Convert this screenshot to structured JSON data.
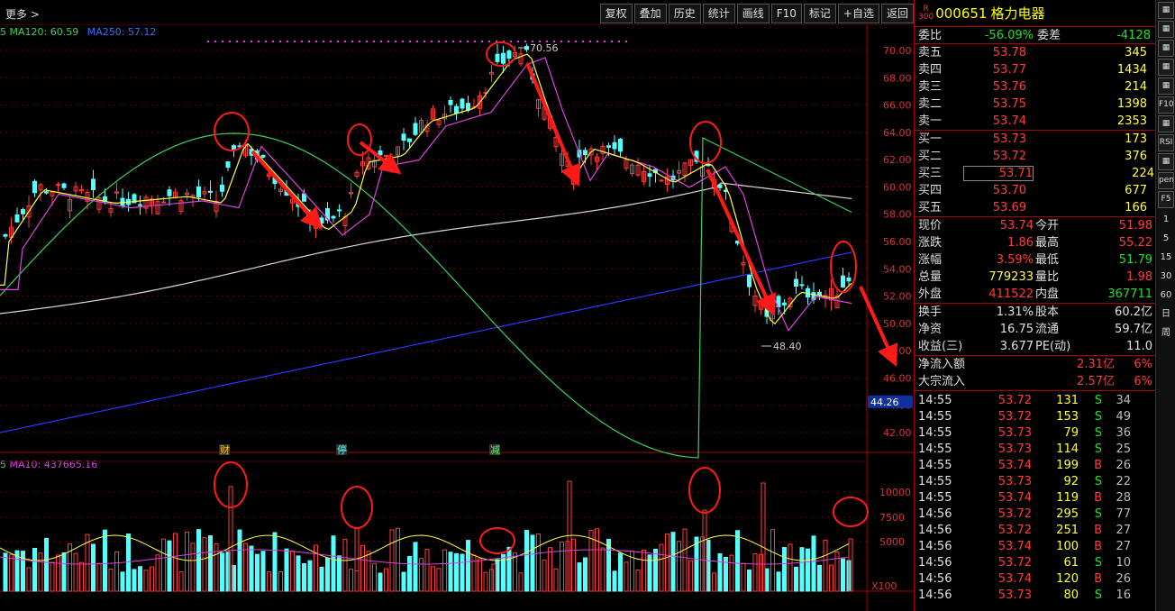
{
  "toolbar": {
    "more": "更多 >",
    "buttons": [
      "复权",
      "叠加",
      "历史",
      "统计",
      "画线",
      "F10",
      "标记",
      "+自选",
      "返回"
    ]
  },
  "chart": {
    "ma120_label": "MA120: 60.59",
    "ma250_label": "MA250: 57.12",
    "vol_label": "MA10: 437665.16",
    "price_ticks": [
      "70.00",
      "68.00",
      "66.00",
      "64.00",
      "62.00",
      "60.00",
      "58.00",
      "56.00",
      "54.00",
      "52.00",
      "50.00",
      "48.00",
      "46.00",
      "44.00",
      "42.00"
    ],
    "highlight_price": "44.26",
    "vol_ticks": [
      "10000",
      "7500",
      "5000"
    ],
    "vol_unit": "X100",
    "high_label": "70.56",
    "low_label": "48.40",
    "events": [
      "财",
      "停",
      "减"
    ],
    "last_tick": "5"
  },
  "stock": {
    "index_tag": "R\n300",
    "code": "000651",
    "name": "格力电器"
  },
  "weibi": {
    "label1": "委比",
    "v1": "-56.09%",
    "label2": "委差",
    "v2": "-4128"
  },
  "sell": [
    {
      "l": "卖五",
      "p": "53.78",
      "v": "345"
    },
    {
      "l": "卖四",
      "p": "53.77",
      "v": "1434"
    },
    {
      "l": "卖三",
      "p": "53.76",
      "v": "214"
    },
    {
      "l": "卖二",
      "p": "53.75",
      "v": "1398"
    },
    {
      "l": "卖一",
      "p": "53.74",
      "v": "2353"
    }
  ],
  "buy": [
    {
      "l": "买一",
      "p": "53.73",
      "v": "173"
    },
    {
      "l": "买二",
      "p": "53.72",
      "v": "376"
    },
    {
      "l": "买三",
      "p": "53.71",
      "v": "224"
    },
    {
      "l": "买四",
      "p": "53.70",
      "v": "677"
    },
    {
      "l": "买五",
      "p": "53.69",
      "v": "166"
    }
  ],
  "quote": [
    {
      "a": "现价",
      "av": "53.74",
      "b": "今开",
      "bv": "51.98"
    },
    {
      "a": "涨跌",
      "av": "1.86",
      "b": "最高",
      "bv": "55.22"
    },
    {
      "a": "涨幅",
      "av": "3.59%",
      "b": "最低",
      "bv": "51.79"
    },
    {
      "a": "总量",
      "av": "779233",
      "b": "量比",
      "bv": "1.98"
    },
    {
      "a": "外盘",
      "av": "411522",
      "b": "内盘",
      "bv": "367711"
    }
  ],
  "info": [
    {
      "a": "换手",
      "av": "1.31%",
      "b": "股本",
      "bv": "60.2亿"
    },
    {
      "a": "净资",
      "av": "16.75",
      "b": "流通",
      "bv": "59.7亿"
    },
    {
      "a": "收益(三)",
      "av": "3.677",
      "b": "PE(动)",
      "bv": "11.0"
    }
  ],
  "flow": [
    {
      "a": "净流入额",
      "av": "2.31亿",
      "b": "6%"
    },
    {
      "a": "大宗流入",
      "av": "2.57亿",
      "b": "6%"
    }
  ],
  "ticks": [
    {
      "t": "14:55",
      "p": "53.72",
      "v": "131",
      "s": "S",
      "n": "34"
    },
    {
      "t": "14:55",
      "p": "53.72",
      "v": "153",
      "s": "S",
      "n": "49"
    },
    {
      "t": "14:55",
      "p": "53.73",
      "v": "79",
      "s": "S",
      "n": "36"
    },
    {
      "t": "14:55",
      "p": "53.73",
      "v": "114",
      "s": "S",
      "n": "25"
    },
    {
      "t": "14:55",
      "p": "53.74",
      "v": "199",
      "s": "B",
      "n": "26"
    },
    {
      "t": "14:55",
      "p": "53.73",
      "v": "92",
      "s": "S",
      "n": "22"
    },
    {
      "t": "14:55",
      "p": "53.74",
      "v": "119",
      "s": "B",
      "n": "28"
    },
    {
      "t": "14:56",
      "p": "53.72",
      "v": "295",
      "s": "S",
      "n": "77"
    },
    {
      "t": "14:56",
      "p": "53.72",
      "v": "251",
      "s": "B",
      "n": "27"
    },
    {
      "t": "14:56",
      "p": "53.74",
      "v": "100",
      "s": "B",
      "n": "27"
    },
    {
      "t": "14:56",
      "p": "53.72",
      "v": "61",
      "s": "S",
      "n": "10"
    },
    {
      "t": "14:56",
      "p": "53.74",
      "v": "120",
      "s": "B",
      "n": "26"
    },
    {
      "t": "14:56",
      "p": "53.73",
      "v": "80",
      "s": "S",
      "n": "16"
    }
  ],
  "sidebar": [
    "flag",
    "tools",
    "cols",
    "grid",
    "list",
    "F10",
    "zoom",
    "RSI",
    "move",
    "pen",
    "F5",
    "1",
    "5",
    "15",
    "30",
    "60",
    "日",
    "周"
  ]
}
